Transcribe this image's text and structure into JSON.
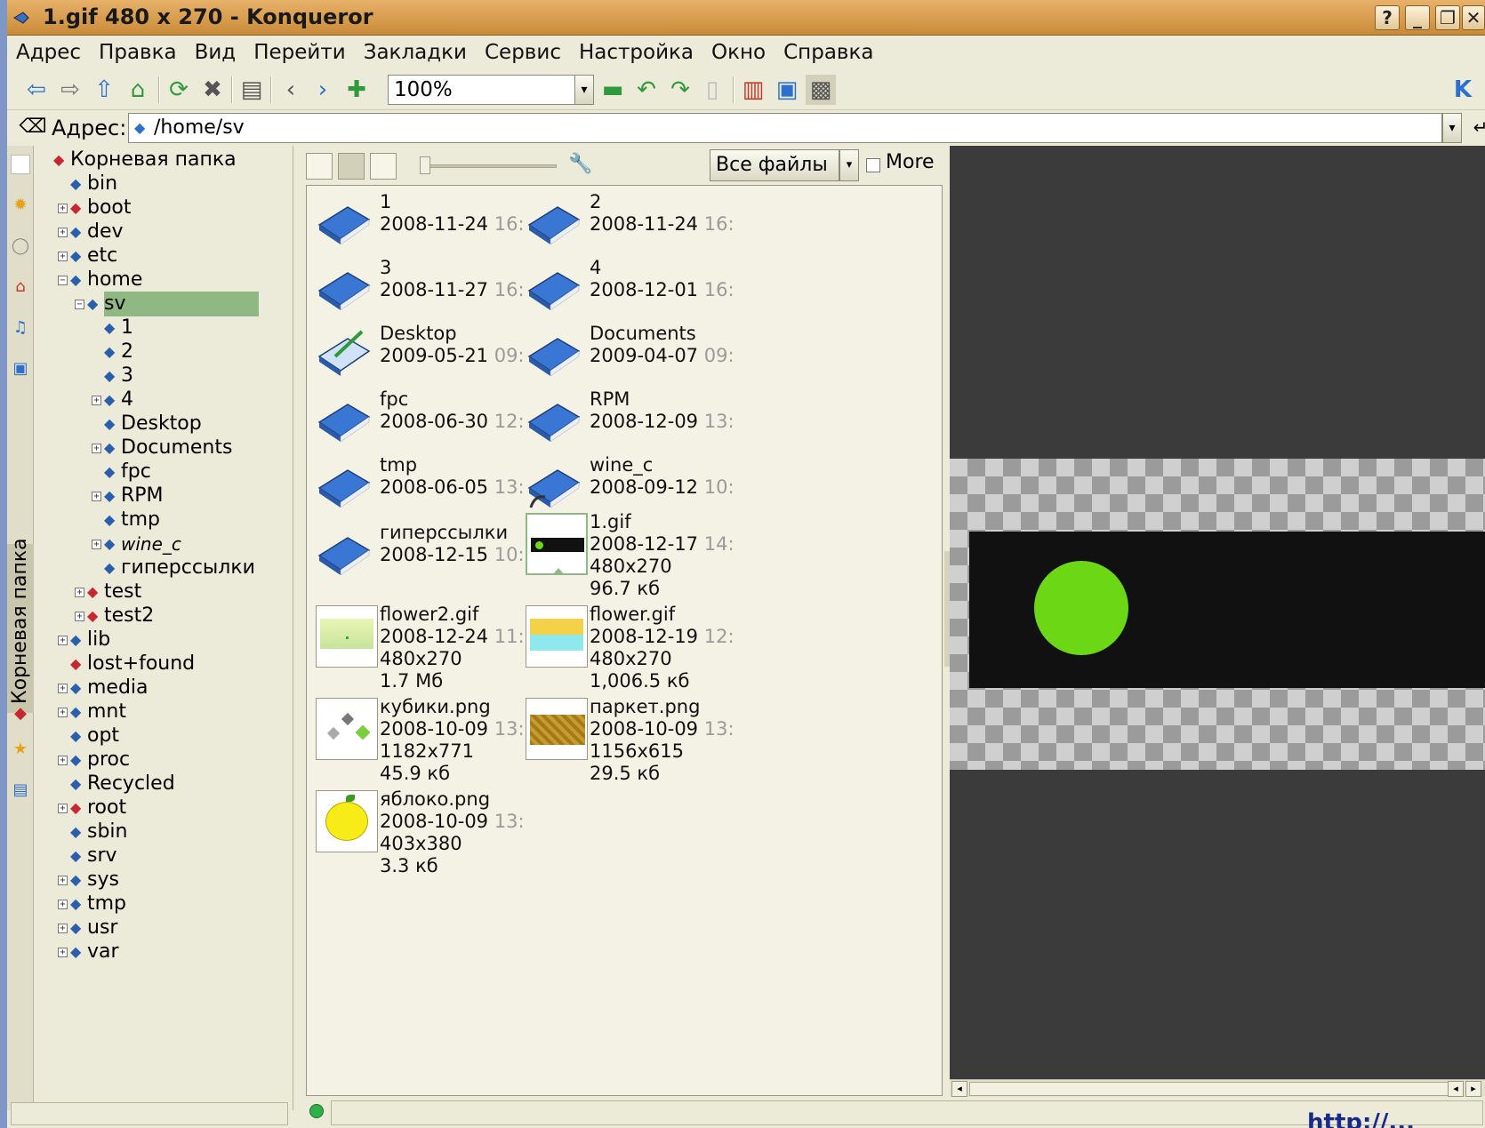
{
  "window": {
    "title": "1.gif 480 x 270 - Konqueror"
  },
  "titlebar_buttons": [
    "?",
    "_",
    "❐",
    "✕"
  ],
  "menu": [
    "Адрес",
    "Правка",
    "Вид",
    "Перейти",
    "Закладки",
    "Сервис",
    "Настройка",
    "Окно",
    "Справка"
  ],
  "toolbar": {
    "zoom": "100%"
  },
  "address": {
    "label": "Адрес:",
    "value": "/home/sv"
  },
  "sidebar": {
    "tab_label": "Корневая папка",
    "tree": [
      {
        "label": "Корневая папка",
        "expander": "",
        "red": true
      },
      {
        "label": "bin",
        "expander": ""
      },
      {
        "label": "boot",
        "expander": "⊞",
        "red": true
      },
      {
        "label": "dev",
        "expander": "⊞"
      },
      {
        "label": "etc",
        "expander": "⊞"
      },
      {
        "label": "home",
        "expander": "⊟"
      },
      {
        "label": "sv",
        "expander": "⊟"
      },
      {
        "label": "1",
        "expander": ""
      },
      {
        "label": "2",
        "expander": ""
      },
      {
        "label": "3",
        "expander": ""
      },
      {
        "label": "4",
        "expander": "⊞"
      },
      {
        "label": "Desktop",
        "expander": ""
      },
      {
        "label": "Documents",
        "expander": "⊞"
      },
      {
        "label": "fpc",
        "expander": ""
      },
      {
        "label": "RPM",
        "expander": "⊞"
      },
      {
        "label": "tmp",
        "expander": ""
      },
      {
        "label": "wine_c",
        "expander": "⊞"
      },
      {
        "label": "гиперссылки",
        "expander": ""
      },
      {
        "label": "test",
        "expander": "⊞",
        "red": true
      },
      {
        "label": "test2",
        "expander": "⊞",
        "red": true
      },
      {
        "label": "lib",
        "expander": "⊞"
      },
      {
        "label": "lost+found",
        "expander": "",
        "red": true
      },
      {
        "label": "media",
        "expander": "⊞"
      },
      {
        "label": "mnt",
        "expander": "⊞"
      },
      {
        "label": "opt",
        "expander": ""
      },
      {
        "label": "proc",
        "expander": "⊞"
      },
      {
        "label": "Recycled",
        "expander": ""
      },
      {
        "label": "root",
        "expander": "⊞",
        "red": true
      },
      {
        "label": "sbin",
        "expander": ""
      },
      {
        "label": "srv",
        "expander": ""
      },
      {
        "label": "sys",
        "expander": "⊞"
      },
      {
        "label": "tmp",
        "expander": "⊞"
      },
      {
        "label": "usr",
        "expander": "⊞"
      },
      {
        "label": "var",
        "expander": "⊞"
      }
    ]
  },
  "filepane": {
    "filter": "Все файлы",
    "more": "More",
    "items": [
      {
        "name": "1",
        "date": "2008-11-24",
        "time": "16:",
        "kind": "folder"
      },
      {
        "name": "2",
        "date": "2008-11-24",
        "time": "16:",
        "kind": "folder"
      },
      {
        "name": "3",
        "date": "2008-11-27",
        "time": "16:",
        "kind": "folder"
      },
      {
        "name": "4",
        "date": "2008-12-01",
        "time": "16:",
        "kind": "folder"
      },
      {
        "name": "Desktop",
        "date": "2009-05-21",
        "time": "09:",
        "kind": "desktop"
      },
      {
        "name": "Documents",
        "date": "2009-04-07",
        "time": "09:",
        "kind": "folder"
      },
      {
        "name": "fpc",
        "date": "2008-06-30",
        "time": "12:",
        "kind": "folder"
      },
      {
        "name": "RPM",
        "date": "2008-12-09",
        "time": "13:",
        "kind": "folder"
      },
      {
        "name": "tmp",
        "date": "2008-06-05",
        "time": "13:",
        "kind": "folder"
      },
      {
        "name": "wine_c",
        "date": "2008-09-12",
        "time": "10:",
        "kind": "folder"
      },
      {
        "name": "гиперссылки",
        "date": "2008-12-15",
        "time": "10:",
        "kind": "folder"
      },
      {
        "name": "1.gif",
        "date": "2008-12-17",
        "time": "14:",
        "dims": "480x270",
        "size": "96.7 кб",
        "kind": "gif"
      },
      {
        "name": "flower2.gif",
        "date": "2008-12-24",
        "time": "11:",
        "dims": "480x270",
        "size": "1.7 Мб",
        "kind": "flower2"
      },
      {
        "name": "flower.gif",
        "date": "2008-12-19",
        "time": "12:",
        "dims": "480x270",
        "size": "1,006.5 кб",
        "kind": "flower"
      },
      {
        "name": "кубики.png",
        "date": "2008-10-09",
        "time": "13:",
        "dims": "1182x771",
        "size": "45.9 кб",
        "kind": "cubes"
      },
      {
        "name": "паркет.png",
        "date": "2008-10-09",
        "time": "13:",
        "dims": "1156x615",
        "size": "29.5 кб",
        "kind": "parquet"
      },
      {
        "name": "яблоко.png",
        "date": "2008-10-09",
        "time": "13:",
        "dims": "403x380",
        "size": "3.3 кб",
        "kind": "apple"
      }
    ]
  },
  "footer_link": "http://..."
}
